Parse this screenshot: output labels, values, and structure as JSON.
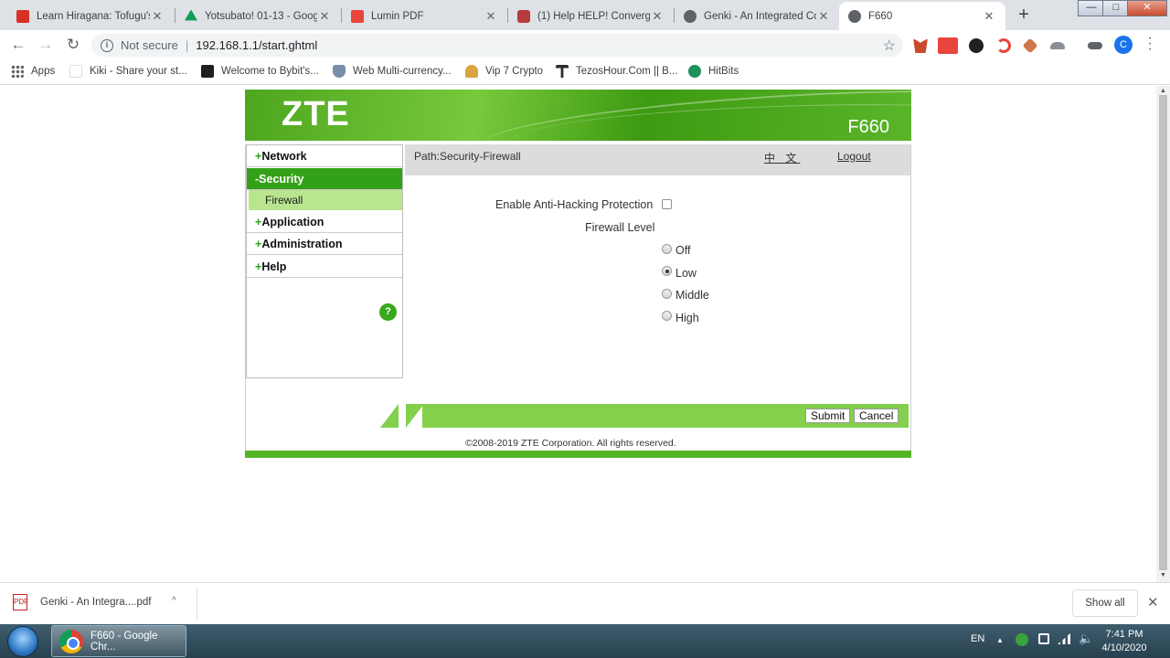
{
  "browser": {
    "tabs": [
      {
        "title": "Learn Hiragana: Tofugu's",
        "icon_color": "#d93025"
      },
      {
        "title": "Yotsubato! 01-13 - Goog",
        "icon_color": "#0f9d58"
      },
      {
        "title": "Lumin PDF",
        "icon_color": "#e8453c"
      },
      {
        "title": "(1) Help HELP! Converge",
        "icon_color": "#b63b3b"
      },
      {
        "title": "Genki - An Integrated Co",
        "icon_color": "#5f6368"
      },
      {
        "title": "F660",
        "icon_color": "#5f6368"
      }
    ],
    "window_controls": {
      "minimize": "—",
      "maximize": "□",
      "close": "✕"
    },
    "new_tab": "+",
    "tab_close": "✕",
    "address": {
      "security_label": "Not secure",
      "url": "192.168.1.1/start.ghtml",
      "info_icon": "i"
    },
    "nav": {
      "back": "←",
      "forward": "→",
      "reload": "↻",
      "star": "☆"
    },
    "profile_initial": "C",
    "bookmarks": [
      {
        "label": "Apps",
        "icon_color": "#5f6368"
      },
      {
        "label": "Kiki - Share your st...",
        "icon_color": "#ffffff"
      },
      {
        "label": "Welcome to Bybit's...",
        "icon_color": "#1f1f1f"
      },
      {
        "label": "Web Multi-currency...",
        "icon_color": "#7a8ea8"
      },
      {
        "label": "Vip 7 Crypto",
        "icon_color": "#d9a441"
      },
      {
        "label": "TezosHour.Com || B...",
        "icon_color": "#2c2c2c"
      },
      {
        "label": "HitBits",
        "icon_color": "#1e8e5a"
      }
    ]
  },
  "router": {
    "brand": "ZTE",
    "model": "F660",
    "nav": {
      "network": "Network",
      "security": "Security",
      "firewall": "Firewall",
      "application": "Application",
      "administration": "Administration",
      "help": "Help",
      "expand_mark": "+",
      "collapse_mark": "-"
    },
    "help_icon": "?",
    "path": "Path:Security-Firewall",
    "language_link": "中 文",
    "logout_link": "Logout",
    "form": {
      "anti_hacking_label": "Enable Anti-Hacking Protection",
      "anti_hacking_checked": false,
      "firewall_level_label": "Firewall Level",
      "levels": [
        "Off",
        "Low",
        "Middle",
        "High"
      ],
      "selected_level": "Low"
    },
    "submit_label": "Submit",
    "cancel_label": "Cancel",
    "copyright": "©2008-2019 ZTE Corporation. All rights reserved.",
    "accent_color": "#33a117"
  },
  "downloads": {
    "file": "Genki - An Integra....pdf",
    "file_icon": "PDF",
    "show_all": "Show all",
    "chevron": "^",
    "close": "✕"
  },
  "taskbar": {
    "task_label": "F660 - Google Chr...",
    "language": "EN",
    "time": "7:41 PM",
    "date": "4/10/2020"
  }
}
